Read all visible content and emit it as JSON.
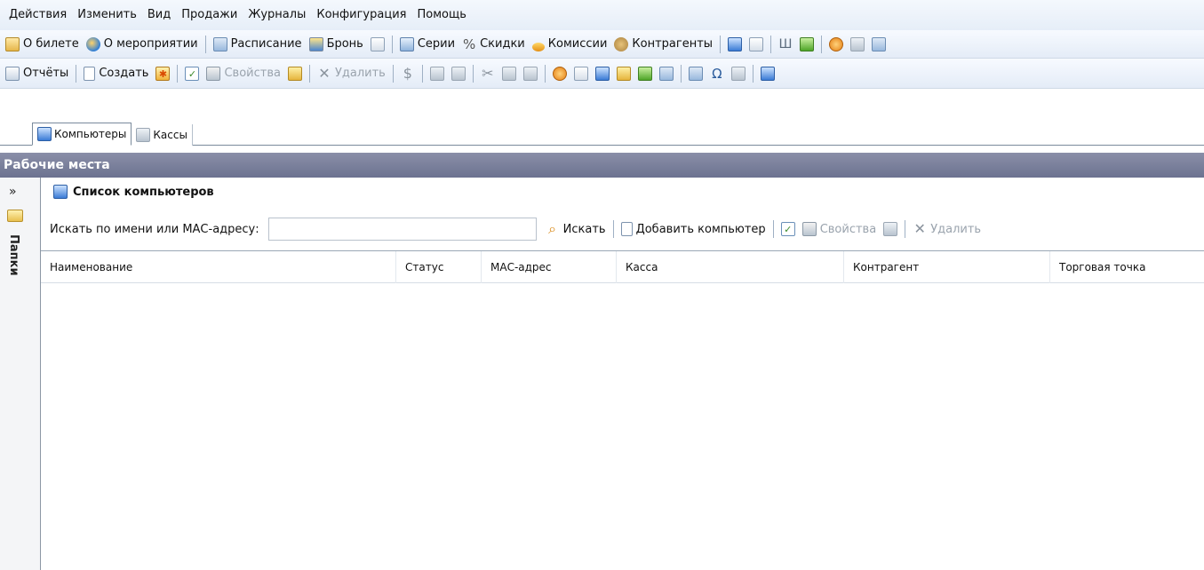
{
  "menu": [
    "Действия",
    "Изменить",
    "Вид",
    "Продажи",
    "Журналы",
    "Конфигурация",
    "Помощь"
  ],
  "toolbar1": {
    "ticket": "О билете",
    "event": "О мероприятии",
    "schedule": "Расписание",
    "booking": "Бронь",
    "series": "Серии",
    "discounts": "Скидки",
    "commissions": "Комиссии",
    "partners": "Контрагенты"
  },
  "toolbar2": {
    "reports": "Отчёты",
    "create": "Создать",
    "properties": "Свойства",
    "delete": "Удалить"
  },
  "tabs": [
    {
      "label": "Компьютеры",
      "icon": "computers-icon"
    },
    {
      "label": "Кассы",
      "icon": "cash-registers-icon"
    }
  ],
  "panel": {
    "title": "Рабочие места",
    "folders": "Папки",
    "expand": "»"
  },
  "list": {
    "title": "Список компьютеров",
    "search_label": "Искать по имени или МАС-адресу:",
    "search_value": "",
    "search_button": "Искать",
    "add_button": "Добавить компьютер",
    "properties_button": "Свойства",
    "delete_button": "Удалить"
  },
  "grid": {
    "columns": [
      "Наименование",
      "Статус",
      "МАС-адрес",
      "Касса",
      "Контрагент",
      "Торговая точка"
    ],
    "rows": []
  }
}
